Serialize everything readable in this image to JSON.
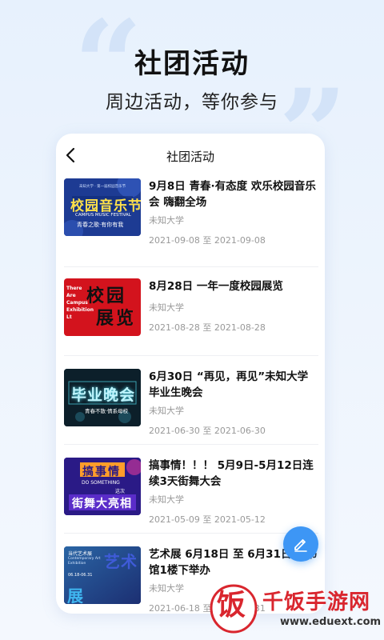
{
  "hero": {
    "title": "社团活动",
    "subtitle": "周边活动，等你参与"
  },
  "screen": {
    "nav_title": "社团活动"
  },
  "events": [
    {
      "title": "9月8日 青春·有态度 欢乐校园音乐会 嗨翻全场",
      "org": "未知大学",
      "date": "2021-09-08 至 2021-09-08",
      "thumb": {
        "bg": "#1f3e96",
        "accent": "#ffe14a",
        "lines": [
          "校园音乐节",
          "CAMPUS MUSIC FESTIVAL",
          "青春之歌·有你有我"
        ]
      }
    },
    {
      "title": "8月28日 一年一度校园展览",
      "org": "未知大学",
      "date": "2021-08-28 至 2021-08-28",
      "thumb": {
        "bg": "#d3131d",
        "accent": "#111111",
        "lines": [
          "校园",
          "展览",
          "There Are Campus Exhibition Lt"
        ]
      }
    },
    {
      "title": "6月30日 “再见，再见”未知大学毕业生晚会",
      "org": "未知大学",
      "date": "2021-06-30 至 2021-06-30",
      "thumb": {
        "bg": "#0c1f2a",
        "accent": "#4fd6e8",
        "lines": [
          "毕业晚会",
          "青春不散·情系母校"
        ]
      }
    },
    {
      "title": "搞事情！！！ 5月9日-5月12日连续3天街舞大会",
      "org": "未知大学",
      "date": "2021-05-09 至 2021-05-12",
      "thumb": {
        "bg": "#2a1a86",
        "accent": "#ff9d2a",
        "lines": [
          "搞事情",
          "DO SOMETHING",
          "这次",
          "街舞大亮相"
        ]
      }
    },
    {
      "title": "艺术展 6月18日 至 6月31日 图书馆1楼下举办",
      "org": "未知大学",
      "date": "2021-06-18 至 2021-06-31",
      "thumb": {
        "bg": "#203a8a",
        "accent": "#3fb6f0",
        "lines": [
          "艺术",
          "展",
          "当代艺术展",
          "Contemporary Art Exhibition",
          "06.18-06.31"
        ]
      }
    }
  ],
  "watermark": {
    "name": "千饭手游网",
    "url": "www.eduext.com",
    "badge_char": "饭"
  },
  "colors": {
    "accent": "#3d96f5",
    "background": "#e9f2fd",
    "watermark_red": "#d9262e"
  },
  "icons": {
    "back": "chevron-left-icon",
    "fab": "pencil-icon"
  }
}
